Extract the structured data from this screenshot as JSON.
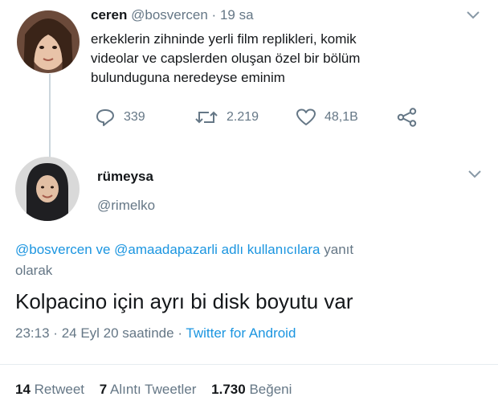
{
  "original_tweet": {
    "name": "ceren",
    "handle": "@bosvercen",
    "separator": "·",
    "time": "19 sa",
    "text_lines": [
      "erkeklerin zihninde yerli film replikleri, komik",
      "videolar ve capslerden oluşan özel bir bölüm",
      "bulunduguna neredeyse eminim"
    ],
    "actions": {
      "reply_count": "339",
      "retweet_count": "2.219",
      "like_count": "48,1B"
    }
  },
  "reply_tweet": {
    "name": "rümeysa",
    "handle": "@rimelko",
    "replying_to": {
      "user1": "@bosvercen",
      "connector": "ve",
      "user2": "@amaadapazarli",
      "suffix_link": "adlı kullanıcılara",
      "suffix_tail": "yanıt",
      "line2": "olarak"
    },
    "text": "Kolpacino için ayrı bi disk boyutu var",
    "meta": {
      "time": "23:13",
      "sep1": "·",
      "date": "24 Eyl 20 saatinde",
      "sep2": "·",
      "source": "Twitter for Android"
    },
    "stats": {
      "retweets_num": "14",
      "retweets_label": "Retweet",
      "quotes_num": "7",
      "quotes_label": "Alıntı Tweetler",
      "likes_num": "1.730",
      "likes_label": "Beğeni"
    }
  },
  "colors": {
    "accent": "#1b95e0",
    "muted": "#657786",
    "text": "#14171a"
  }
}
